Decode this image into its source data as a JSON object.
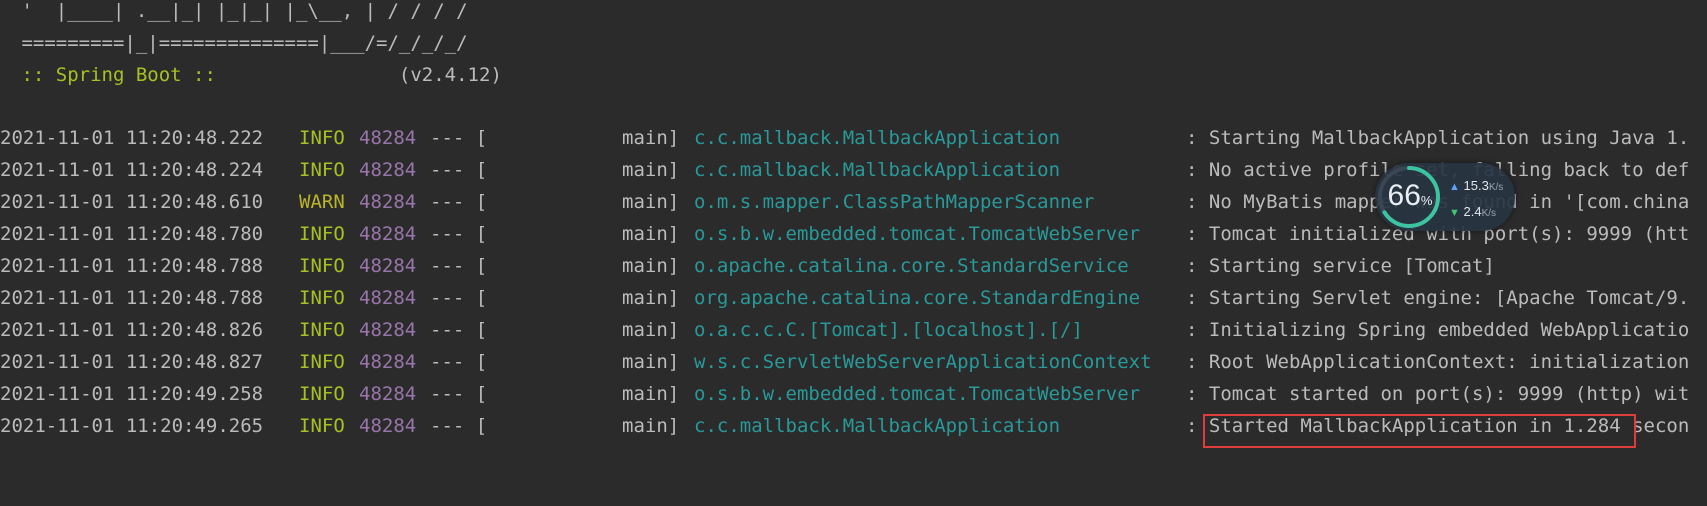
{
  "banner": {
    "line1": " '  |____| .__|_| |_|_| |_\\__, | / / / /",
    "line2": " =========|_|==============|___/=/_/_/_/",
    "spring_label": " :: Spring Boot :: ",
    "version": "               (v2.4.12)"
  },
  "logs": [
    {
      "ts": "2021-11-01 11:20:48.222",
      "level": "INFO",
      "pid": "48284",
      "sep": "--- [",
      "thread": "main]",
      "logger": "c.c.mallback.MallbackApplication",
      "msg": ": Starting MallbackApplication using Java 1."
    },
    {
      "ts": "2021-11-01 11:20:48.224",
      "level": "INFO",
      "pid": "48284",
      "sep": "--- [",
      "thread": "main]",
      "logger": "c.c.mallback.MallbackApplication",
      "msg": ": No active profile set, falling back to def"
    },
    {
      "ts": "2021-11-01 11:20:48.610",
      "level": "WARN",
      "pid": "48284",
      "sep": "--- [",
      "thread": "main]",
      "logger": "o.m.s.mapper.ClassPathMapperScanner",
      "msg": ": No MyBatis mapper was found in '[com.china"
    },
    {
      "ts": "2021-11-01 11:20:48.780",
      "level": "INFO",
      "pid": "48284",
      "sep": "--- [",
      "thread": "main]",
      "logger": "o.s.b.w.embedded.tomcat.TomcatWebServer",
      "msg": ": Tomcat initialized with port(s): 9999 (htt"
    },
    {
      "ts": "2021-11-01 11:20:48.788",
      "level": "INFO",
      "pid": "48284",
      "sep": "--- [",
      "thread": "main]",
      "logger": "o.apache.catalina.core.StandardService",
      "msg": ": Starting service [Tomcat]"
    },
    {
      "ts": "2021-11-01 11:20:48.788",
      "level": "INFO",
      "pid": "48284",
      "sep": "--- [",
      "thread": "main]",
      "logger": "org.apache.catalina.core.StandardEngine",
      "msg": ": Starting Servlet engine: [Apache Tomcat/9."
    },
    {
      "ts": "2021-11-01 11:20:48.826",
      "level": "INFO",
      "pid": "48284",
      "sep": "--- [",
      "thread": "main]",
      "logger": "o.a.c.c.C.[Tomcat].[localhost].[/]",
      "msg": ": Initializing Spring embedded WebApplicatio"
    },
    {
      "ts": "2021-11-01 11:20:48.827",
      "level": "INFO",
      "pid": "48284",
      "sep": "--- [",
      "thread": "main]",
      "logger": "w.s.c.ServletWebServerApplicationContext",
      "msg": ": Root WebApplicationContext: initialization"
    },
    {
      "ts": "2021-11-01 11:20:49.258",
      "level": "INFO",
      "pid": "48284",
      "sep": "--- [",
      "thread": "main]",
      "logger": "o.s.b.w.embedded.tomcat.TomcatWebServer",
      "msg": ": Tomcat started on port(s): 9999 (http) wit"
    },
    {
      "ts": "2021-11-01 11:20:49.265",
      "level": "INFO",
      "pid": "48284",
      "sep": "--- [",
      "thread": "main]",
      "logger": "c.c.mallback.MallbackApplication",
      "msg": ": Started MallbackApplication in 1.284 secon"
    }
  ],
  "net_widget": {
    "percent": "66",
    "percent_sign": "%",
    "percent_value": 0.66,
    "upload": "15.3",
    "download": "2.4",
    "unit": "K/s",
    "up_icon": "arrow-up-icon",
    "down_icon": "arrow-down-icon"
  },
  "colors": {
    "background": "#2b2b2b",
    "info": "#a8c023",
    "warn": "#bbb529",
    "pid": "#9876aa",
    "logger": "#299999",
    "highlight": "#e03c3c"
  }
}
